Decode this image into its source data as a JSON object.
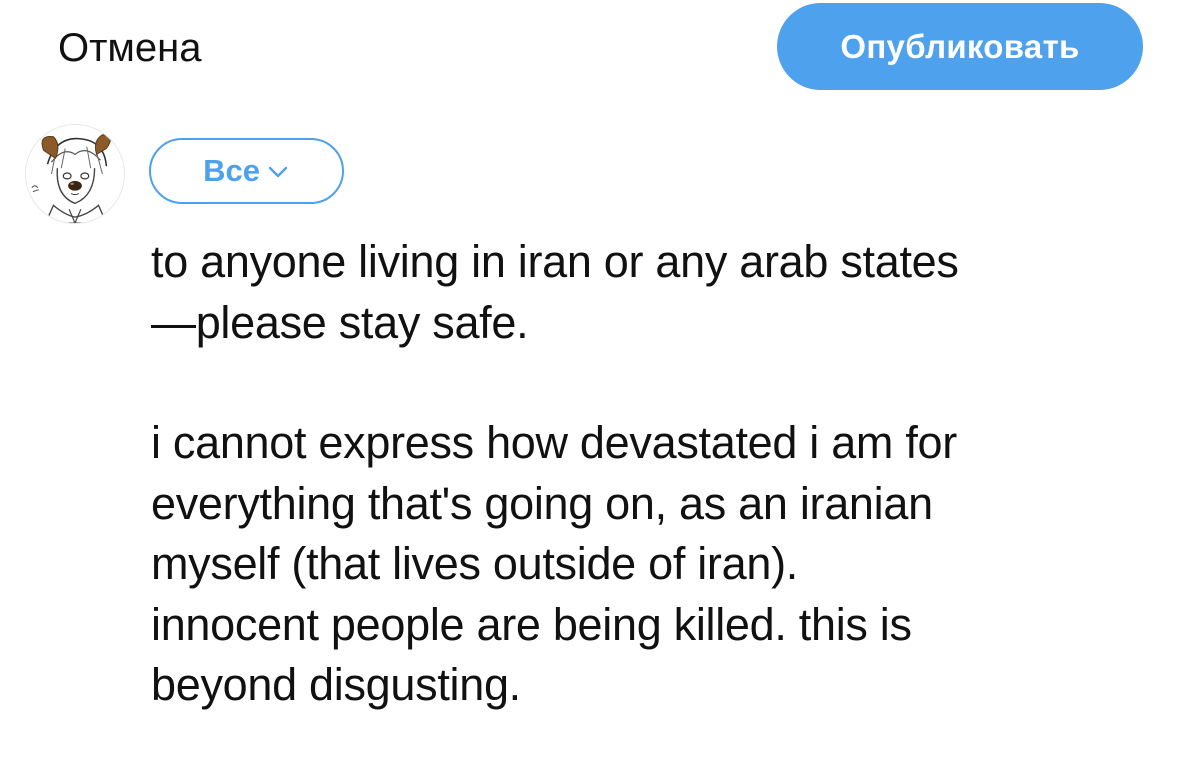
{
  "header": {
    "cancel_label": "Отмена",
    "publish_label": "Опубликовать"
  },
  "colors": {
    "accent": "#4ea1ec",
    "text": "#111111",
    "background": "#ffffff"
  },
  "composer": {
    "avatar_icon": "user-avatar",
    "audience_label": "Все",
    "audience_icon": "chevron-down-icon",
    "text": {
      "paragraph_1_line_1": "to anyone living in iran or any arab states",
      "paragraph_1_line_2": "—please stay safe.",
      "paragraph_2_line_1": "i cannot express how devastated i am for",
      "paragraph_2_line_2": "everything that's going on, as an iranian",
      "paragraph_2_line_3": "myself (that lives outside of iran).",
      "paragraph_2_line_4": "innocent people are being killed. this is",
      "paragraph_2_line_5": "beyond disgusting."
    }
  }
}
